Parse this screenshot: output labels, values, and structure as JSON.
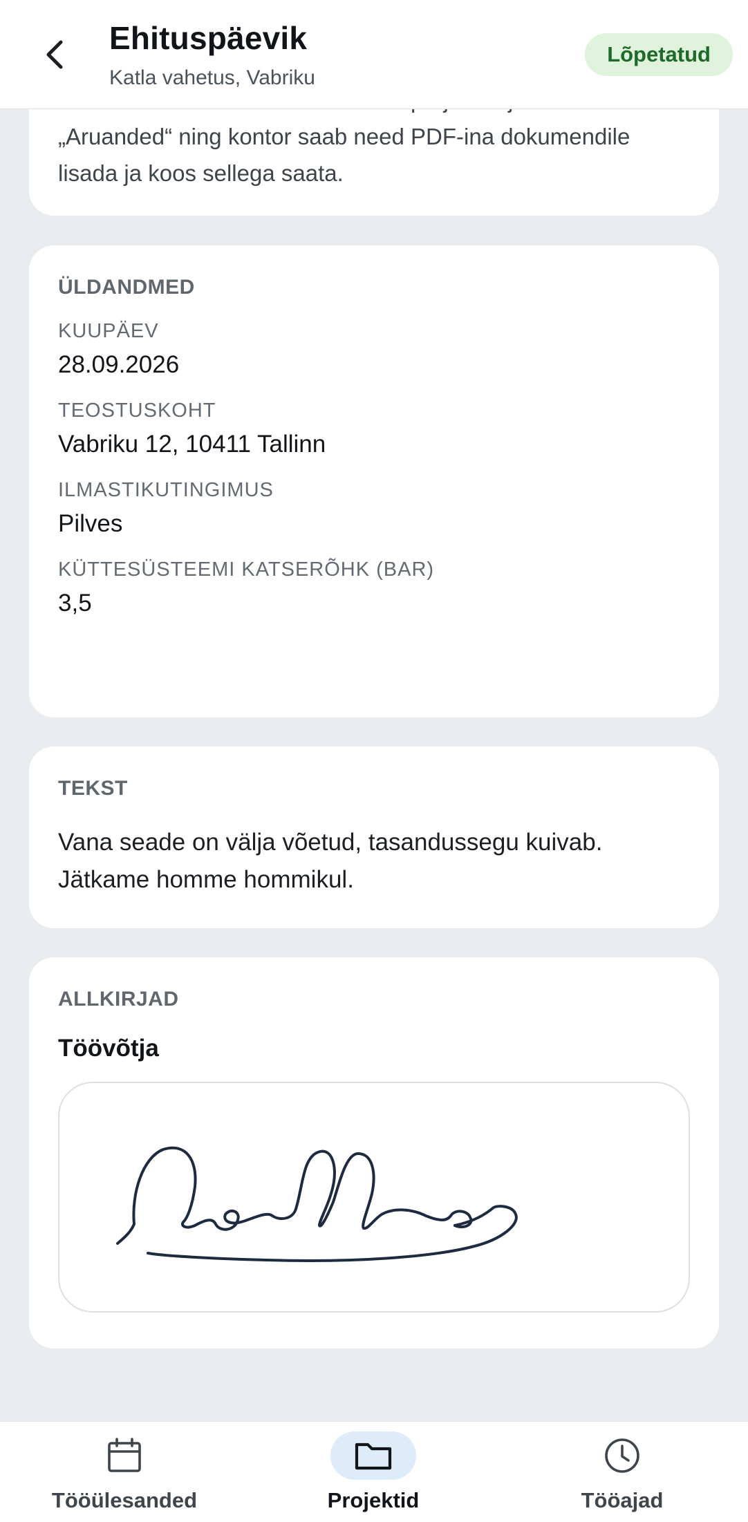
{
  "header": {
    "title": "Ehituspäevik",
    "subtitle": "Katla vahetus, Vabriku",
    "status": "Lõpetatud"
  },
  "intro": {
    "text": "salvestatakse. Kontoris leiab need projektist jaotisest „Aruanded“ ning kontor saab need PDF-ina dokumendile lisada ja koos sellega saata."
  },
  "general": {
    "title": "ÜLDANDMED",
    "fields": [
      {
        "label": "KUUPÄEV",
        "value": "28.09.2026"
      },
      {
        "label": "TEOSTUSKOHT",
        "value": "Vabriku 12, 10411 Tallinn"
      },
      {
        "label": "ILMASTIKUTINGIMUS",
        "value": "Pilves"
      },
      {
        "label": "KÜTTESÜSTEEMI KATSERÕHK (BAR)",
        "value": "3,5"
      }
    ]
  },
  "text_section": {
    "title": "TEKST",
    "body": "Vana seade on välja võetud, tasandussegu kuivab. Jätkame homme hommikul."
  },
  "signatures": {
    "title": "ALLKIRJAD",
    "signer": "Töövõtja"
  },
  "nav": {
    "items": [
      {
        "label": "Tööülesanded",
        "icon": "calendar-icon",
        "active": false
      },
      {
        "label": "Projektid",
        "icon": "folder-icon",
        "active": true
      },
      {
        "label": "Tööajad",
        "icon": "clock-icon",
        "active": false
      }
    ]
  },
  "colors": {
    "background": "#e9ecef",
    "card": "#ffffff",
    "status_badge_bg": "#dff3dc",
    "status_badge_text": "#1f6a2a",
    "nav_active_bg": "#deebf8",
    "signature_ink": "#1e2a3f"
  }
}
